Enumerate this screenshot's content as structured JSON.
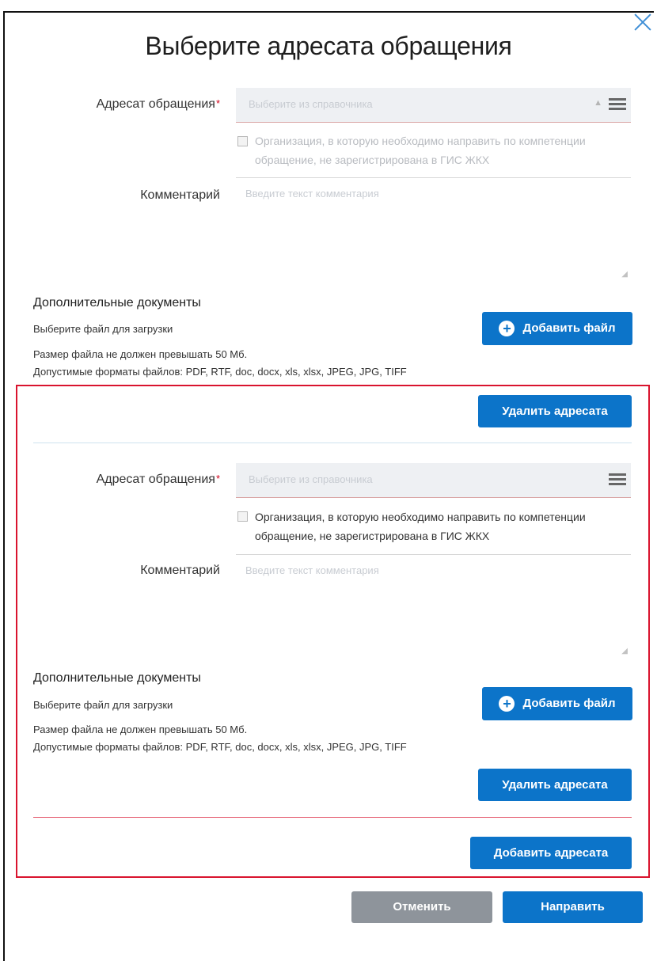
{
  "dialog": {
    "title": "Выберите адресата обращения"
  },
  "labels": {
    "addressee": "Адресат обращения",
    "required_mark": "*",
    "checkbox": "Организация, в которую необходимо направить по компетенции обращение, не зарегистрирована в ГИС ЖКХ",
    "comment": "Комментарий",
    "additional_docs": "Дополнительные документы",
    "choose_file": "Выберите файл для загрузки",
    "size_limit": "Размер файла не должен превышать 50 Мб.",
    "formats": "Допустимые форматы файлов: PDF, RTF, doc, docx, xls, xlsx, JPEG, JPG, TIFF"
  },
  "blocks": [
    {
      "addressee_placeholder": "Выберите из справочника",
      "comment_placeholder": "Введите текст комментария",
      "add_file_button": "Добавить файл",
      "remove_button": "Удалить адресата"
    },
    {
      "addressee_placeholder": "Выберите из справочника",
      "comment_placeholder": "Введите текст комментария",
      "add_file_button": "Добавить файл",
      "remove_button": "Удалить адресата"
    }
  ],
  "buttons": {
    "add_addressee": "Добавить адресата",
    "cancel": "Отменить",
    "send": "Направить"
  },
  "icons": {
    "close": "close-icon",
    "list": "burger-menu-icon",
    "add": "plus-circle-icon",
    "resize": "resize-grip-icon"
  },
  "colors": {
    "primary": "#0c74c9",
    "secondary": "#8e949b",
    "highlight": "#d9142e",
    "required": "#d0021b"
  }
}
